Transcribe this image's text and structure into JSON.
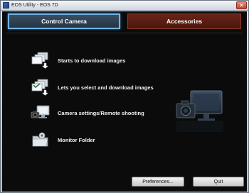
{
  "window": {
    "title": "EOS Utility - EOS 7D",
    "close_glyph": "×"
  },
  "tabs": [
    {
      "label": "Control Camera",
      "state": "active"
    },
    {
      "label": "Accessories",
      "state": "inactive"
    }
  ],
  "menu": [
    {
      "label": "Starts to download images",
      "icon": "download-images-icon"
    },
    {
      "label": "Lets you select and download images",
      "icon": "select-download-icon"
    },
    {
      "label": "Camera settings/Remote shooting",
      "icon": "camera-remote-icon"
    },
    {
      "label": "Monitor Folder",
      "icon": "monitor-folder-icon"
    }
  ],
  "buttons": {
    "preferences": "Preferences...",
    "quit": "Quit"
  },
  "colors": {
    "active_tab_border": "#6fb4e6",
    "inactive_tab": "#5a1c12",
    "panel_background": "#0b0b0b"
  }
}
